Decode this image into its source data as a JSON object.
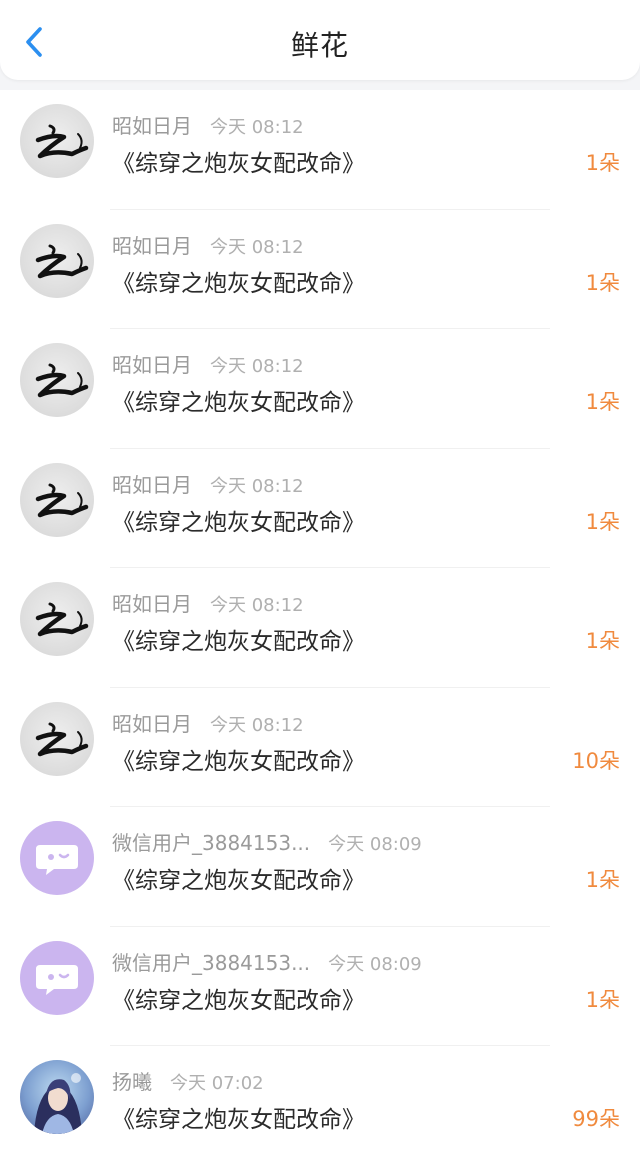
{
  "header": {
    "title": "鲜花",
    "back_icon": "chevron-left-icon"
  },
  "colors": {
    "accent": "#2b8ff0",
    "count": "#f08a3e",
    "wechat_avatar": "#cbb5ef"
  },
  "items": [
    {
      "name": "昭如日月",
      "time": "今天 08:12",
      "book": "《综穿之炮灰女配改命》",
      "count": "1朵",
      "avatar": "ink-avatar"
    },
    {
      "name": "昭如日月",
      "time": "今天 08:12",
      "book": "《综穿之炮灰女配改命》",
      "count": "1朵",
      "avatar": "ink-avatar"
    },
    {
      "name": "昭如日月",
      "time": "今天 08:12",
      "book": "《综穿之炮灰女配改命》",
      "count": "1朵",
      "avatar": "ink-avatar"
    },
    {
      "name": "昭如日月",
      "time": "今天 08:12",
      "book": "《综穿之炮灰女配改命》",
      "count": "1朵",
      "avatar": "ink-avatar"
    },
    {
      "name": "昭如日月",
      "time": "今天 08:12",
      "book": "《综穿之炮灰女配改命》",
      "count": "1朵",
      "avatar": "ink-avatar"
    },
    {
      "name": "昭如日月",
      "time": "今天 08:12",
      "book": "《综穿之炮灰女配改命》",
      "count": "10朵",
      "avatar": "ink-avatar"
    },
    {
      "name": "微信用户_3884153...",
      "time": "今天 08:09",
      "book": "《综穿之炮灰女配改命》",
      "count": "1朵",
      "avatar": "wechat-avatar"
    },
    {
      "name": "微信用户_3884153...",
      "time": "今天 08:09",
      "book": "《综穿之炮灰女配改命》",
      "count": "1朵",
      "avatar": "wechat-avatar"
    },
    {
      "name": "扬曦",
      "time": "今天 07:02",
      "book": "《综穿之炮灰女配改命》",
      "count": "99朵",
      "avatar": "portrait-avatar"
    }
  ]
}
